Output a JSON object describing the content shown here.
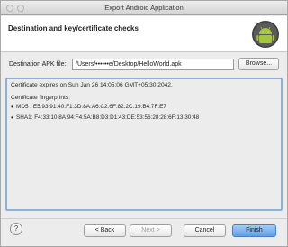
{
  "window": {
    "title": "Export Android Application"
  },
  "header": {
    "title": "Destination and key/certificate checks",
    "logo_icon": "android-icon"
  },
  "form": {
    "apk_label": "Destination APK file:",
    "apk_value": "/Users/••••••e/Desktop/HelloWorld.apk",
    "browse_label": "Browse..."
  },
  "info": {
    "expiry": "Certificate expires on Sun Jan 26 14:05:06 GMT+05:30 2042.",
    "fingerprints_label": "Certificate fingerprints:",
    "fingerprints": [
      "MD5 : E5:93:91:40:F1:3D:8A:A6:C2:6F:82:2C:19:B4:7F:E7",
      "SHA1: F4:33:10:8A:94:F4:5A:B8:D3:D1:43:DE:53:56:28:28:6F:13:30:48"
    ]
  },
  "footer": {
    "help_label": "?",
    "back_label": "< Back",
    "next_label": "Next >",
    "cancel_label": "Cancel",
    "finish_label": "Finish"
  },
  "colors": {
    "accent": "#5d9ee6",
    "panel_border": "#8db0d6",
    "android_green": "#a4c639"
  }
}
